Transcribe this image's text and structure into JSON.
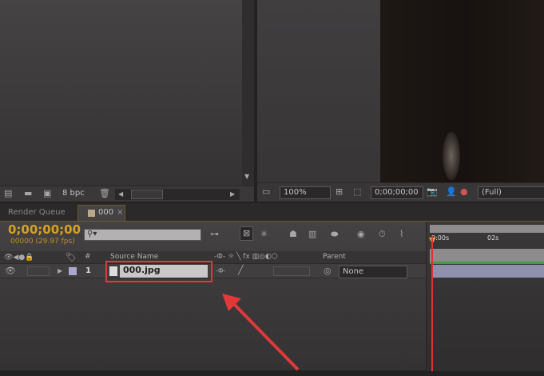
{
  "project": {
    "bpc": "8 bpc"
  },
  "viewer": {
    "zoom": "100%",
    "timecode": "0;00;00;00",
    "resolution": "(Full)"
  },
  "tabs": [
    {
      "label": "Render Queue"
    },
    {
      "label": "000"
    }
  ],
  "timeline": {
    "timecode": "0;00;00;00",
    "frame_info": "00000 (29.97 fps)",
    "search_placeholder": "",
    "columns": {
      "num": "#",
      "source": "Source Name",
      "parent": "Parent"
    },
    "layer": {
      "index": "1",
      "name": "000.jpg",
      "parent": "None"
    },
    "ruler": [
      "0:00s",
      "02s"
    ]
  },
  "colors": {
    "accent": "#d6a21e",
    "highlight": "#e0393a",
    "track": "#8f8fae"
  }
}
